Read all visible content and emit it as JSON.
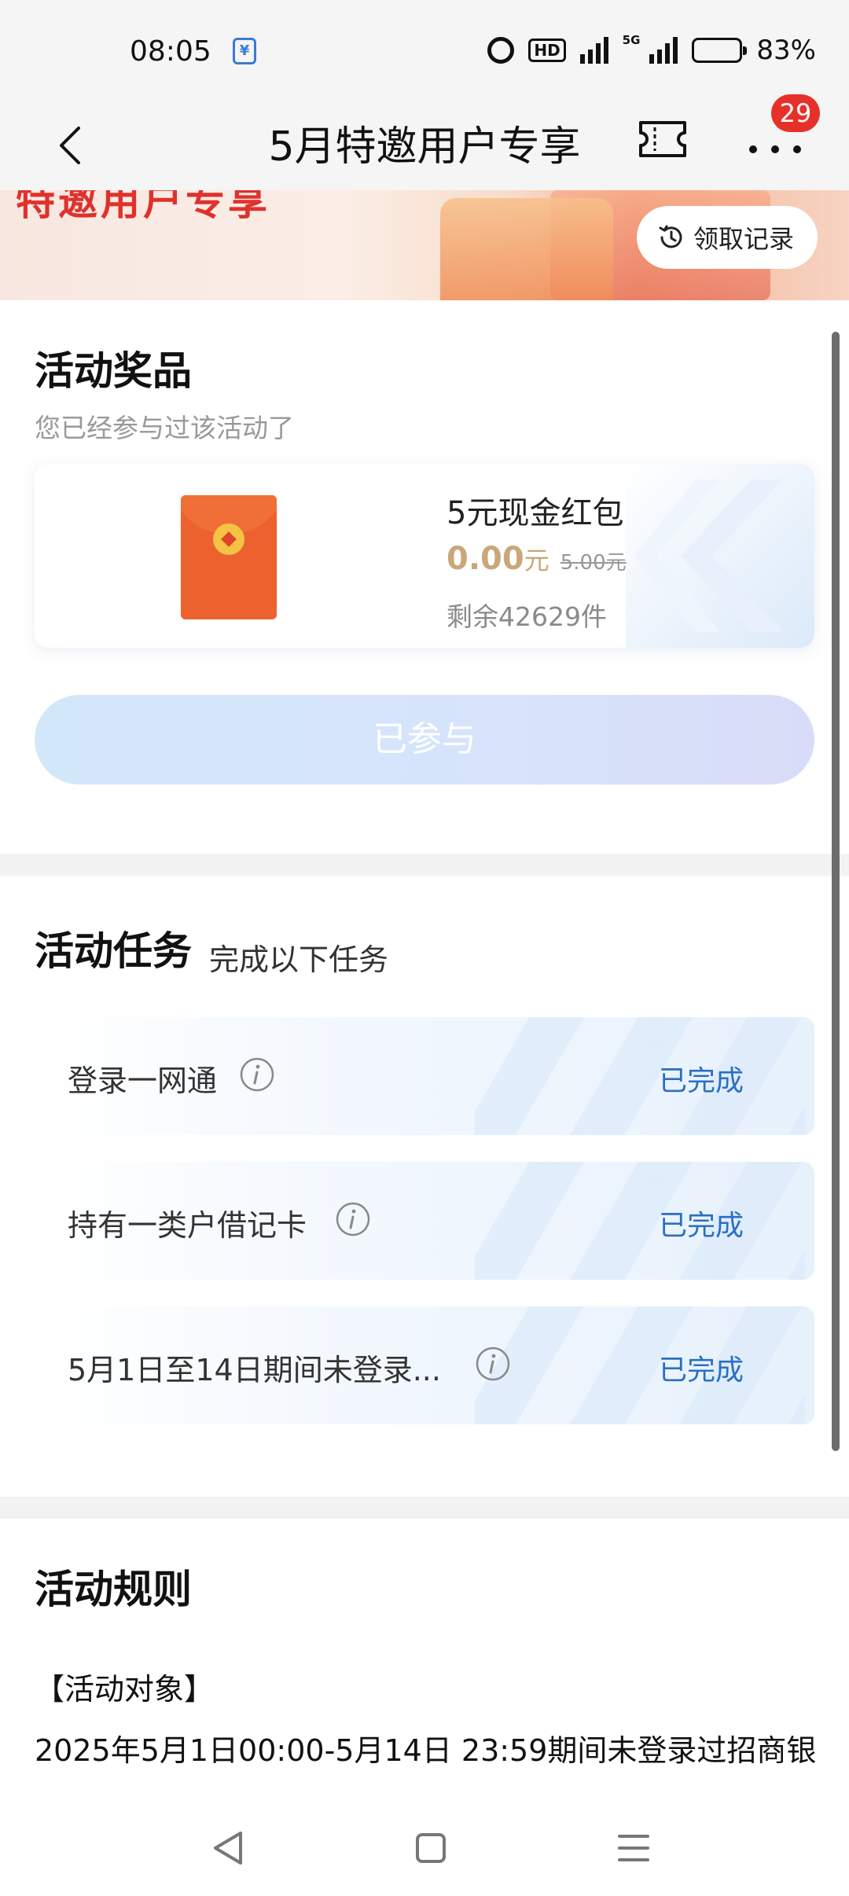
{
  "status_bar": {
    "time": "08:05",
    "network": "5G",
    "battery": "83%",
    "battery_level": 0.83
  },
  "header": {
    "title": "5月特邀用户专享",
    "badge_count": "29"
  },
  "banner": {
    "text": "特邀用户专享",
    "record_label": "领取记录"
  },
  "prize_section": {
    "title": "活动奖品",
    "subtitle": "您已经参与过该活动了",
    "prize": {
      "name": "5元现金红包",
      "price": "0.00",
      "unit": "元",
      "original_price": "5.00元",
      "stock": "剩余42629件"
    },
    "button_label": "已参与"
  },
  "task_section": {
    "title": "活动任务",
    "subtitle": "完成以下任务",
    "tasks": [
      {
        "label": "登录一网通",
        "status": "已完成"
      },
      {
        "label": "持有一类户借记卡",
        "status": "已完成"
      },
      {
        "label": "5月1日至14日期间未登录...",
        "status": "已完成"
      }
    ]
  },
  "rules_section": {
    "title": "活动规则",
    "subtitle": "【活动对象】",
    "text": "2025年5月1日00:00-5月14日 23:59期间未登录过招商银"
  },
  "colors": {
    "accent_blue": "#2a6fc4",
    "badge_red": "#e8302a",
    "price_gold": "#c9a77a",
    "redpack": "#ec612e"
  }
}
